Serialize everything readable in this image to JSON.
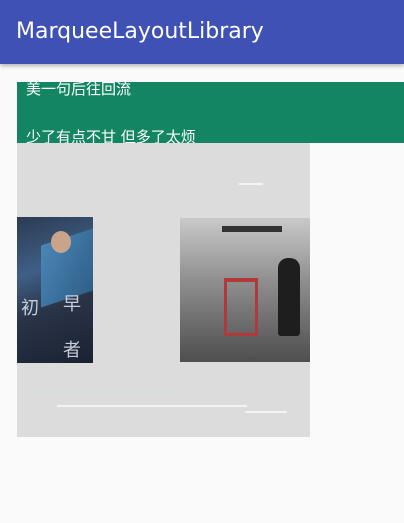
{
  "app_bar": {
    "title": "MarqueeLayoutLibrary"
  },
  "text_marquee": {
    "lines": [
      "美一句后往回流",
      "少了有点不甘 但多了太烦"
    ],
    "background_color": "#138562"
  },
  "image_marquee": {
    "items": [
      {
        "caption_chars": [
          "初",
          "早",
          "者"
        ]
      },
      {
        "caption_chars": []
      }
    ]
  },
  "colors": {
    "app_bar": "#3f51b5",
    "page_background": "#fafafa",
    "image_pane": "#dcdcdc"
  }
}
